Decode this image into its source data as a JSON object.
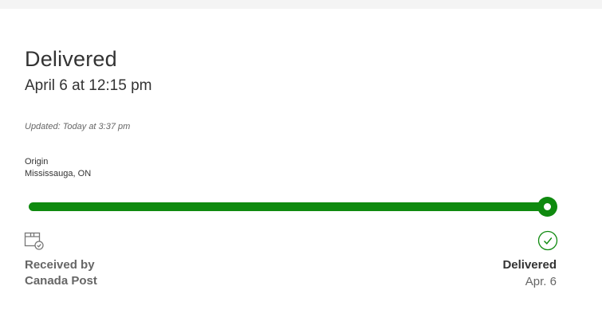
{
  "status": {
    "title": "Delivered",
    "date": "April 6 at 12:15 pm",
    "updated": "Updated: Today at 3:37 pm"
  },
  "origin": {
    "label": "Origin",
    "value": "Mississauga, ON"
  },
  "progress": {
    "fraction": 1.0,
    "color": "#0f8a0f"
  },
  "start": {
    "icon": "package-check-icon",
    "line1": "Received by",
    "line2": "Canada Post"
  },
  "end": {
    "icon": "checkmark-circle-icon",
    "label": "Delivered",
    "date": "Apr. 6"
  }
}
